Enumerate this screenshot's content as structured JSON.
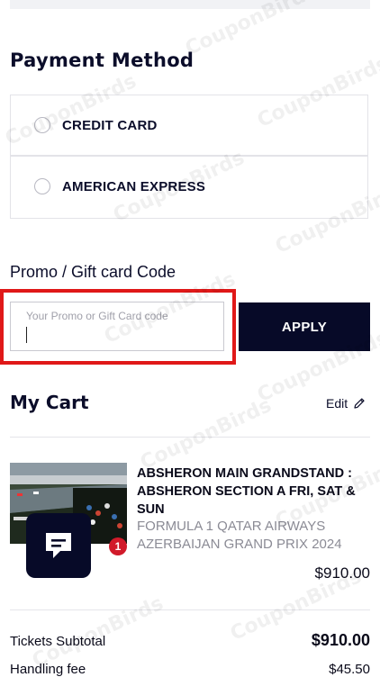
{
  "payment": {
    "title": "Payment Method",
    "options": [
      {
        "label": "CREDIT CARD",
        "selected": false
      },
      {
        "label": "AMERICAN EXPRESS",
        "selected": false
      }
    ]
  },
  "promo": {
    "title": "Promo / Gift card Code",
    "placeholder": "Your Promo or Gift Card code",
    "value": "",
    "apply_label": "APPLY"
  },
  "cart": {
    "title": "My Cart",
    "edit_label": "Edit",
    "items": [
      {
        "name": "ABSHERON MAIN GRANDSTAND : ABSHERON SECTION A FRI, SAT & SUN",
        "event": "FORMULA 1 QATAR AIRWAYS AZERBAIJAN GRAND PRIX 2024",
        "price": "$910.00"
      }
    ],
    "subtotal_label": "Tickets Subtotal",
    "subtotal_value": "$910.00",
    "handling_label": "Handling fee",
    "handling_value": "$45.50"
  },
  "chat": {
    "badge_count": "1"
  },
  "watermark": "CouponBirds",
  "colors": {
    "brand_navy": "#070a28",
    "highlight_red": "#e01818",
    "badge_red": "#d11a2a"
  }
}
